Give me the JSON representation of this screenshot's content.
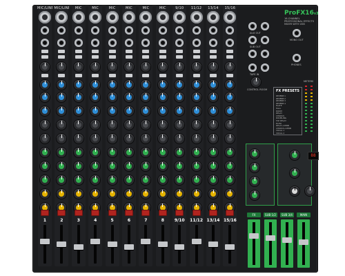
{
  "brand": {
    "name": "ProFX16",
    "suffix": "v3",
    "tagline": "16-CHANNEL PROFESSIONAL EFFECTS MIXER WITH USB"
  },
  "channels": [
    {
      "top_label": "MIC/LINE",
      "num": "1",
      "mono": true
    },
    {
      "top_label": "MIC/LINE",
      "num": "2",
      "mono": true
    },
    {
      "top_label": "MIC",
      "num": "3",
      "mono": true
    },
    {
      "top_label": "MIC",
      "num": "4",
      "mono": true
    },
    {
      "top_label": "MIC",
      "num": "5",
      "mono": true
    },
    {
      "top_label": "MIC",
      "num": "6",
      "mono": true
    },
    {
      "top_label": "MIC",
      "num": "7",
      "mono": true
    },
    {
      "top_label": "MIC",
      "num": "8",
      "mono": true
    },
    {
      "top_label": "9/10",
      "num": "9/10",
      "mono": false
    },
    {
      "top_label": "11/12",
      "num": "11/12",
      "mono": false
    },
    {
      "top_label": "13/14",
      "num": "13/14",
      "mono": false
    },
    {
      "top_label": "15/16",
      "num": "15/16",
      "mono": false
    }
  ],
  "master": {
    "sections": {
      "aux": "AUX OUT",
      "sub": "SUB OUT",
      "phones": "PHONES",
      "control_room": "CONTROL ROOM",
      "fx_presets": "FX PRESETS",
      "meters": "METERS",
      "tape": "TAPE IN",
      "mono": "MONO OUT"
    },
    "fx_presets": [
      "REVERB 1",
      "REVERB 2",
      "REVERB 3",
      "REVERB 4",
      "PLATE",
      "HALL",
      "ROOM",
      "DELAY",
      "CHORUS",
      "DOUBLING",
      "TAP DELAY",
      "ECHO",
      "DELAY+VERB",
      "CHORUS+VERB",
      "VOCAL 1",
      "VOCAL 2"
    ],
    "fx_display": "88",
    "fader_labels": [
      "FX",
      "SUB 1/2",
      "SUB 3/4",
      "MAIN"
    ]
  }
}
